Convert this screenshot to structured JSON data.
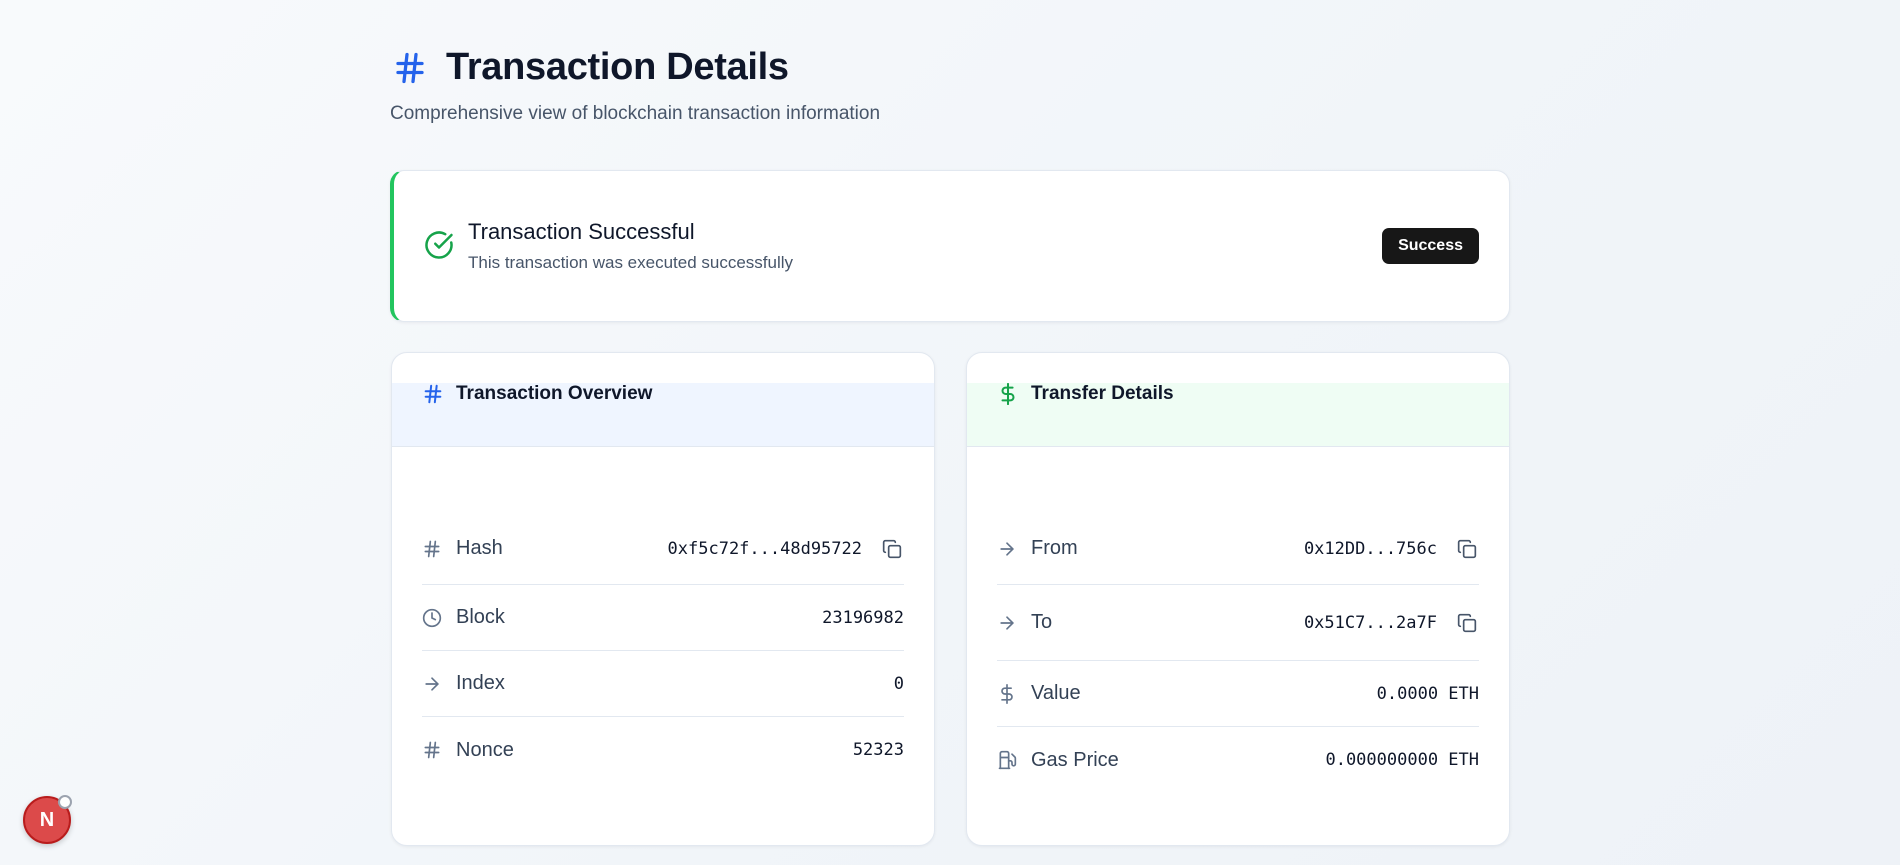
{
  "header": {
    "title": "Transaction Details",
    "subtitle": "Comprehensive view of blockchain transaction information",
    "icon": "hash-icon"
  },
  "status": {
    "title": "Transaction Successful",
    "description": "This transaction was executed successfully",
    "badge": "Success",
    "accent_color": "#22c55e"
  },
  "overview": {
    "title": "Transaction Overview",
    "icon": "hash-icon",
    "rows": [
      {
        "label": "Hash",
        "value": "0xf5c72f...48d95722",
        "icon": "hash-icon",
        "copyable": true
      },
      {
        "label": "Block",
        "value": "23196982",
        "icon": "clock-icon",
        "copyable": false
      },
      {
        "label": "Index",
        "value": "0",
        "icon": "arrow-right-icon",
        "copyable": false
      },
      {
        "label": "Nonce",
        "value": "52323",
        "icon": "hash-icon",
        "copyable": false
      }
    ]
  },
  "transfer": {
    "title": "Transfer Details",
    "icon": "dollar-icon",
    "rows": [
      {
        "label": "From",
        "value": "0x12DD...756c",
        "icon": "arrow-right-icon",
        "copyable": true
      },
      {
        "label": "To",
        "value": "0x51C7...2a7F",
        "icon": "arrow-right-icon",
        "copyable": true
      },
      {
        "label": "Value",
        "value": "0.0000 ETH",
        "icon": "dollar-icon",
        "copyable": false
      },
      {
        "label": "Gas Price",
        "value": "0.000000000 ETH",
        "icon": "fuel-icon",
        "copyable": false
      }
    ]
  },
  "fab": {
    "letter": "N"
  },
  "colors": {
    "brand_blue": "#2563eb",
    "success_green": "#16a34a",
    "badge_bg": "#171717"
  }
}
